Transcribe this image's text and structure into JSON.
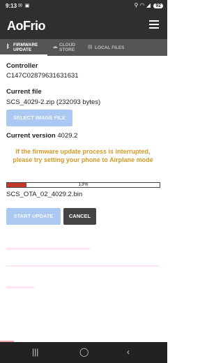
{
  "status_bar": {
    "time": "9:13",
    "battery": "92"
  },
  "app": {
    "logo": "AoFrio"
  },
  "tabs": [
    {
      "label": "FIRMWARE UPDATE",
      "icon": "bluetooth-icon"
    },
    {
      "label": "CLOUD STORE",
      "icon": "cloud-icon"
    },
    {
      "label": "LOCAL FILES",
      "icon": "file-icon"
    }
  ],
  "controller": {
    "label": "Controller",
    "value": "C147C02879631631631"
  },
  "current_file": {
    "label": "Current file",
    "value": "SCS_4029-2.zip (232093 bytes)"
  },
  "select_button": "SELECT IMAGE FILE",
  "current_version": {
    "label": "Current version",
    "value": "4029.2"
  },
  "warning": "If the firmware update process is interrupted, please try setting your phone to Airplane mode",
  "progress": {
    "percent": 13,
    "label": "13%"
  },
  "update_filename": "SCS_OTA_02_4029.2.bin",
  "start_button": "START UPDATE",
  "cancel_button": "CANCEL",
  "colors": {
    "header": "#2f2f2f",
    "tab_bar": "#555555",
    "warning": "#d49a28",
    "progress": "#c0392b",
    "disabled_button": "#aac8f2"
  }
}
